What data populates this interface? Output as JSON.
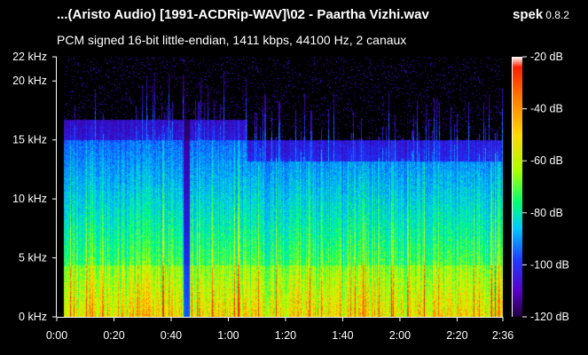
{
  "window": {
    "title": "...(Aristo Audio) [1991-ACDRip-WAV]\\02 - Paartha Vizhi.wav",
    "brand": "spek",
    "version": "0.8.2",
    "subtitle": "PCM signed 16-bit little-endian, 1411 kbps, 44100 Hz, 2 canaux"
  },
  "chart_data": {
    "type": "heatmap",
    "title": "...(Aristo Audio) [1991-ACDRip-WAV]\\02 - Paartha Vizhi.wav",
    "subtitle": "PCM signed 16-bit little-endian, 1411 kbps, 44100 Hz, 2 canaux",
    "xlim": [
      0,
      156
    ],
    "ylim": [
      0,
      22050
    ],
    "x_ticks": [
      {
        "value": 0,
        "label": "0:00"
      },
      {
        "value": 20,
        "label": "0:20"
      },
      {
        "value": 40,
        "label": "0:40"
      },
      {
        "value": 60,
        "label": "1:00"
      },
      {
        "value": 80,
        "label": "1:20"
      },
      {
        "value": 100,
        "label": "1:40"
      },
      {
        "value": 120,
        "label": "2:00"
      },
      {
        "value": 140,
        "label": "2:20"
      },
      {
        "value": 156,
        "label": "2:36"
      }
    ],
    "y_ticks": [
      {
        "value": 0,
        "label": "0 kHz"
      },
      {
        "value": 5000,
        "label": "5 kHz"
      },
      {
        "value": 10000,
        "label": "10 kHz"
      },
      {
        "value": 15000,
        "label": "15 kHz"
      },
      {
        "value": 20000,
        "label": "20 kHz"
      },
      {
        "value": 22050,
        "label": "22 kHz"
      }
    ],
    "colorbar_range": [
      -120,
      -20
    ],
    "colorbar_ticks": [
      {
        "value": -20,
        "label": "-20 dB"
      },
      {
        "value": -40,
        "label": "-40 dB"
      },
      {
        "value": -60,
        "label": "-60 dB"
      },
      {
        "value": -80,
        "label": "-80 dB"
      },
      {
        "value": -100,
        "label": "-100 dB"
      },
      {
        "value": -120,
        "label": "-120 dB"
      }
    ],
    "colors": {
      "background": "#000000",
      "high": "#ff2000",
      "mid": "#ffd800",
      "low_mid": "#00c8ff",
      "low": "#2a00a0"
    }
  }
}
